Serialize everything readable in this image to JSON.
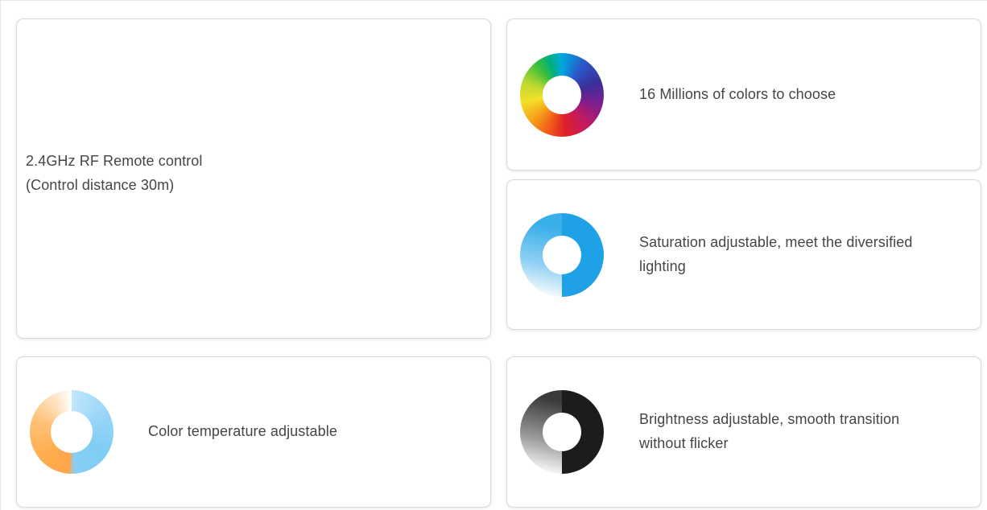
{
  "features": {
    "remote": {
      "line1": "2.4GHz RF Remote control",
      "line2": "(Control distance 30m)"
    },
    "colors": {
      "icon": "rainbow-ring-icon",
      "text": "16 Millions of colors to choose"
    },
    "saturation": {
      "icon": "saturation-ring-icon",
      "line1": "Saturation adjustable, meet the diversified",
      "line2": "lighting"
    },
    "temperature": {
      "icon": "color-temperature-ring-icon",
      "text": "Color temperature adjustable"
    },
    "brightness": {
      "icon": "brightness-ring-icon",
      "line1": "Brightness adjustable, smooth transition",
      "line2": "without flicker"
    }
  },
  "colors": {
    "text": "#454545",
    "card_border": "#dadada",
    "saturation_blue": "#1ea1e6",
    "brightness_dark": "#1c1c1c",
    "temperature_warm": "#ffa54a",
    "temperature_cool": "#86cff4"
  }
}
